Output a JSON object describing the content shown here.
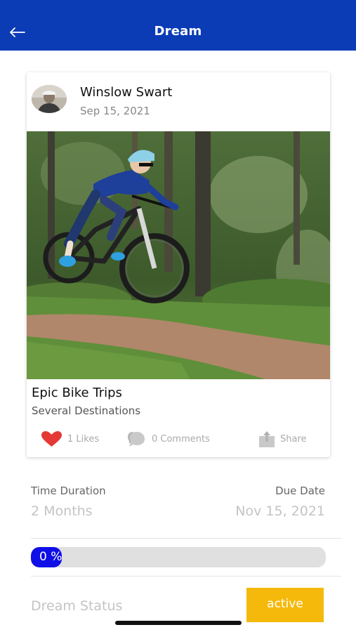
{
  "header": {
    "title": "Dream",
    "back_icon": "arrow-left-icon",
    "background": "#0b3bb5"
  },
  "post": {
    "author": "Winslow Swart",
    "date": "Sep 15, 2021",
    "title": "Epic Bike Trips",
    "subtitle": "Several Destinations",
    "photo": "mountain biker jumping on a dirt trail in a forest",
    "actions": {
      "likes": "1 Likes",
      "comments": "0 Comments",
      "share": "Share"
    }
  },
  "details": {
    "duration_label": "Time Duration",
    "duration_value": "2 Months",
    "due_label": "Due Date",
    "due_value": "Nov 15, 2021",
    "progress_text": "0 %",
    "progress_fraction": 0,
    "status_label": "Dream Status",
    "status_value": "active",
    "status_color": "#f5b90c",
    "progress_color": "#0f0fe6"
  }
}
